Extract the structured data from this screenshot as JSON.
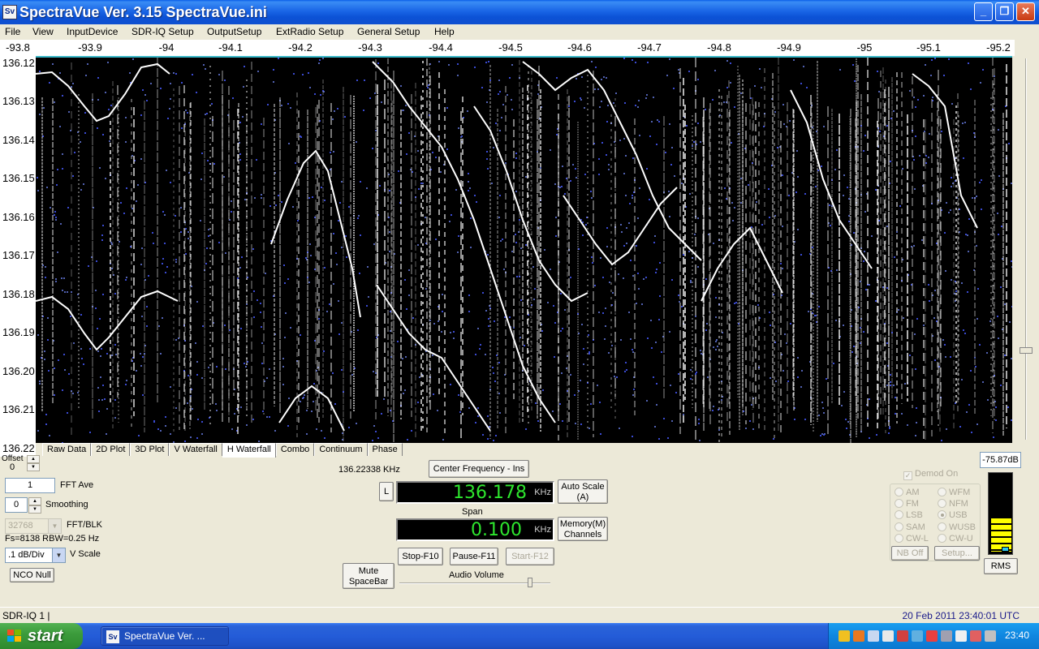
{
  "window": {
    "title": "SpectraVue Ver. 3.15  SpectraVue.ini",
    "icon_label": "Sv",
    "minimize": "_",
    "maximize": "❐",
    "close": "✕"
  },
  "menu": [
    "File",
    "View",
    "InputDevice",
    "SDR-IQ Setup",
    "OutputSetup",
    "ExtRadio Setup",
    "General Setup",
    "Help"
  ],
  "freq_axis_ticks": [
    "-93.8",
    "-93.9",
    "-94",
    "-94.1",
    "-94.2",
    "-94.3",
    "-94.4",
    "-94.5",
    "-94.6",
    "-94.7",
    "-94.8",
    "-94.9",
    "-95",
    "-95.1",
    "-95.2"
  ],
  "time_axis_ticks": [
    "136.12",
    "136.13",
    "136.14",
    "136.15",
    "136.16",
    "136.17",
    "136.18",
    "136.19",
    "136.20",
    "136.21"
  ],
  "time_axis_bottom": "136.22",
  "tabs": [
    "Raw Data",
    "2D Plot",
    "3D Plot",
    "V Waterfall",
    "H Waterfall",
    "Combo",
    "Continuum",
    "Phase"
  ],
  "active_tab": "H Waterfall",
  "controls": {
    "offset_label": "Offset",
    "offset_value": "0",
    "fft_ave_value": "1",
    "fft_ave_label": "FFT Ave",
    "smoothing_value": "0",
    "smoothing_label": "Smoothing",
    "fft_blk_value": "32768",
    "fft_blk_label": "FFT/BLK",
    "fs_rbw": "Fs=8138 RBW=0.25 Hz",
    "vscale_value": ".1 dB/Div",
    "vscale_label": "V Scale",
    "nco_null": "NCO Null"
  },
  "center": {
    "marker_freq": "136.22338 KHz",
    "center_button": "Center Frequency - Ins",
    "l_button": "L",
    "center_value": "136.178",
    "center_unit": "KHz",
    "auto_scale_1": "Auto Scale",
    "auto_scale_2": "(A)",
    "span_label": "Span",
    "span_value": "0.100",
    "span_unit": "KHz",
    "memory_1": "Memory(M)",
    "memory_2": "Channels",
    "mute_1": "Mute",
    "mute_2": "SpaceBar",
    "stop": "Stop-F10",
    "pause": "Pause-F11",
    "start": "Start-F12",
    "audio_volume": "Audio Volume"
  },
  "demod": {
    "demod_on": "Demod On",
    "modes": [
      "AM",
      "WFM",
      "FM",
      "NFM",
      "LSB",
      "USB",
      "SAM",
      "WUSB",
      "CW-L",
      "CW-U"
    ],
    "selected": "USB",
    "nb_off": "NB Off",
    "setup": "Setup..."
  },
  "meter": {
    "db_value": "-75.87dB",
    "rms": "RMS",
    "level": 0.45
  },
  "status": {
    "left": "SDR-IQ 1  |",
    "right": "20 Feb 2011  23:40:01 UTC"
  },
  "taskbar": {
    "start": "start",
    "task": "SpectraVue Ver. ...",
    "clock": "23:40"
  },
  "colors": {
    "lcd_text": "#2ee62e",
    "waterfall_bg": "#000000",
    "trace": "#ffffff",
    "noise": "#3a4ad0",
    "meter_fill": "#ffff00"
  }
}
